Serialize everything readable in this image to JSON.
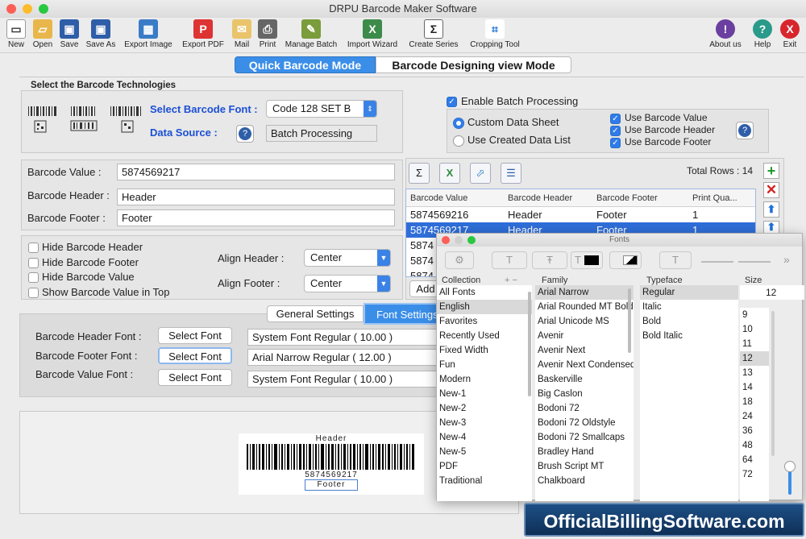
{
  "window": {
    "title": "DRPU Barcode Maker Software"
  },
  "toolbar": [
    {
      "label": "New",
      "icon": "new-file-icon"
    },
    {
      "label": "Open",
      "icon": "open-folder-icon"
    },
    {
      "label": "Save",
      "icon": "save-icon"
    },
    {
      "label": "Save As",
      "icon": "save-as-icon"
    },
    {
      "label": "Export Image",
      "icon": "export-image-icon"
    },
    {
      "label": "Export PDF",
      "icon": "export-pdf-icon"
    },
    {
      "label": "Mail",
      "icon": "mail-icon"
    },
    {
      "label": "Print",
      "icon": "print-icon"
    },
    {
      "label": "Manage Batch",
      "icon": "manage-batch-icon"
    },
    {
      "label": "Import Wizard",
      "icon": "import-wizard-icon"
    },
    {
      "label": "Create Series",
      "icon": "create-series-icon"
    },
    {
      "label": "Cropping Tool",
      "icon": "crop-icon"
    },
    {
      "label": "About us",
      "icon": "about-icon"
    },
    {
      "label": "Help",
      "icon": "help-icon"
    },
    {
      "label": "Exit",
      "icon": "exit-icon"
    }
  ],
  "modes": {
    "quick": "Quick Barcode Mode",
    "design": "Barcode Designing view Mode"
  },
  "tech": {
    "title": "Select the Barcode Technologies",
    "font_label": "Select Barcode Font :",
    "font_value": "Code 128 SET B",
    "source_label": "Data Source :",
    "source_value": "Batch Processing"
  },
  "batch": {
    "enable": "Enable Batch Processing",
    "custom": "Custom Data Sheet",
    "created": "Use Created Data List",
    "use_value": "Use Barcode Value",
    "use_header": "Use Barcode Header",
    "use_footer": "Use Barcode Footer"
  },
  "fields": {
    "value_label": "Barcode Value :",
    "value": "5874569217",
    "header_label": "Barcode Header :",
    "header": "Header",
    "footer_label": "Barcode Footer :",
    "footer": "Footer"
  },
  "options": {
    "hide_header": "Hide Barcode Header",
    "hide_footer": "Hide Barcode Footer",
    "hide_value": "Hide Barcode Value",
    "show_top": "Show Barcode Value in Top",
    "align_header_label": "Align Header :",
    "align_header": "Center",
    "align_footer_label": "Align Footer :",
    "align_footer": "Center"
  },
  "table": {
    "total_rows": "Total Rows : 14",
    "columns": [
      "Barcode Value",
      "Barcode Header",
      "Barcode Footer",
      "Print Qua..."
    ],
    "rows": [
      [
        "5874569216",
        "Header",
        "Footer",
        "1"
      ],
      [
        "5874569217",
        "Header",
        "Footer",
        "1"
      ],
      [
        "5874",
        "",
        "",
        ""
      ],
      [
        "5874",
        "",
        "",
        ""
      ],
      [
        "5874",
        "",
        "",
        ""
      ]
    ],
    "add_label": "Add"
  },
  "tabs": {
    "general": "General Settings",
    "font": "Font Settings"
  },
  "font_settings": {
    "header_label": "Barcode Header Font :",
    "header_value": "System Font Regular ( 10.00 )",
    "footer_label": "Barcode Footer Font :",
    "footer_value": "Arial Narrow Regular ( 12.00 )",
    "value_label": "Barcode Value Font :",
    "value_value": "System Font Regular ( 10.00 )",
    "button": "Select Font"
  },
  "preview": {
    "header": "Header",
    "value": "5874569217",
    "footer": "Footer"
  },
  "fonts_panel": {
    "title": "Fonts",
    "col_collection": "Collection",
    "col_family": "Family",
    "col_typeface": "Typeface",
    "col_size": "Size",
    "size_value": "12",
    "collections": [
      "All Fonts",
      "English",
      "Favorites",
      "Recently Used",
      "Fixed Width",
      "Fun",
      "Modern",
      "New-1",
      "New-2",
      "New-3",
      "New-4",
      "New-5",
      "PDF",
      "Traditional"
    ],
    "families": [
      "Arial Narrow",
      "Arial Rounded MT Bold",
      "Arial Unicode MS",
      "Avenir",
      "Avenir Next",
      "Avenir Next Condensed",
      "Baskerville",
      "Big Caslon",
      "Bodoni 72",
      "Bodoni 72 Oldstyle",
      "Bodoni 72 Smallcaps",
      "Bradley Hand",
      "Brush Script MT",
      "Chalkboard"
    ],
    "typefaces": [
      "Regular",
      "Italic",
      "Bold",
      "Bold Italic"
    ],
    "sizes": [
      "9",
      "10",
      "11",
      "12",
      "13",
      "14",
      "18",
      "24",
      "36",
      "48",
      "64",
      "72"
    ]
  },
  "watermark": "OfficialBillingSoftware.com",
  "colors": {
    "accent": "#2f7bea",
    "mode_active": "#3b8ee8",
    "label_blue": "#1b4fd6"
  }
}
